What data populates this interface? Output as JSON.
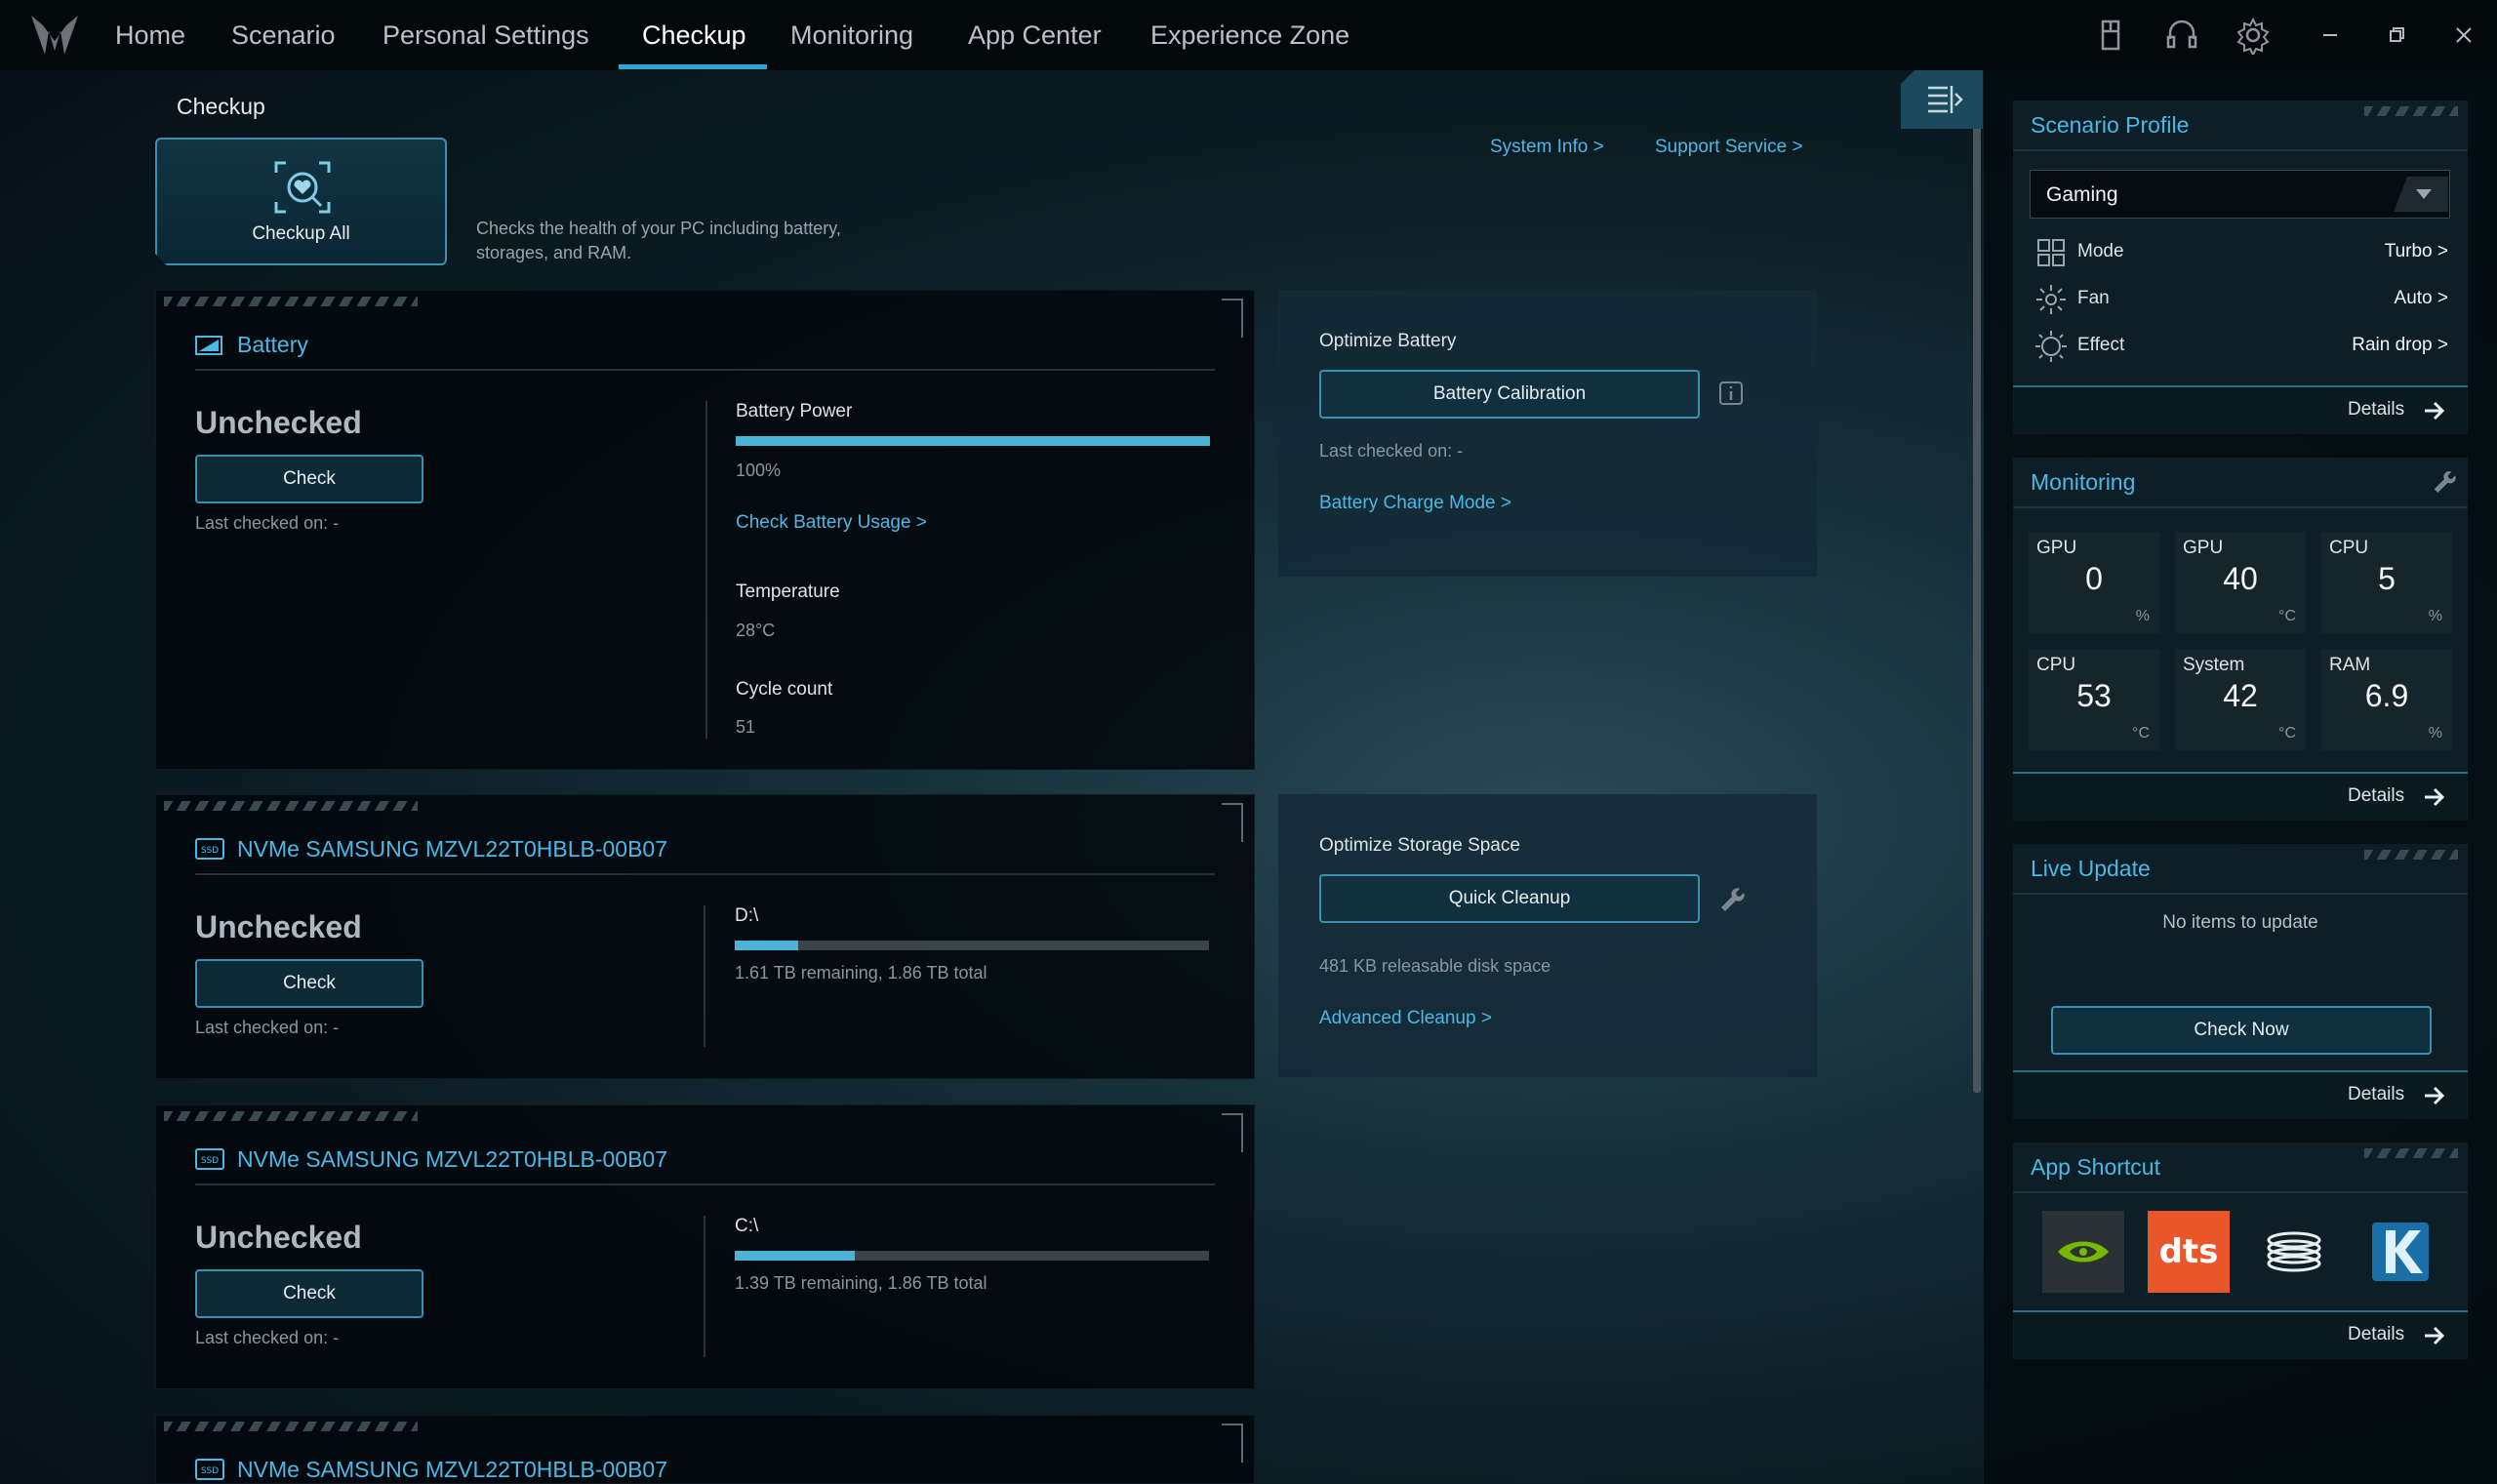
{
  "nav": {
    "tabs": [
      "Home",
      "Scenario",
      "Personal Settings",
      "Checkup",
      "Monitoring",
      "App Center",
      "Experience Zone"
    ],
    "active": "Checkup"
  },
  "page": {
    "title": "Checkup",
    "checkup_all_label": "Checkup All",
    "description": "Checks the health of your PC including battery, storages, and RAM.",
    "system_info_link": "System Info >",
    "support_link": "Support Service >"
  },
  "battery": {
    "title": "Battery",
    "status": "Unchecked",
    "check_label": "Check",
    "last_checked": "Last checked on: -",
    "power_label": "Battery Power",
    "power_value": "100%",
    "power_fraction": 1.0,
    "usage_link": "Check Battery Usage >",
    "temp_label": "Temperature",
    "temp_value": "28°C",
    "cycle_label": "Cycle count",
    "cycle_value": "51"
  },
  "optimize_battery": {
    "title": "Optimize Battery",
    "button": "Battery Calibration",
    "last_checked": "Last checked on: -",
    "charge_mode_link": "Battery Charge Mode >"
  },
  "storages": [
    {
      "title": "NVMe SAMSUNG MZVL22T0HBLB-00B07",
      "status": "Unchecked",
      "check_label": "Check",
      "last_checked": "Last checked on: -",
      "drive": "D:\\",
      "summary": "1.61 TB remaining, 1.86 TB total",
      "used_fraction": 0.134
    },
    {
      "title": "NVMe SAMSUNG MZVL22T0HBLB-00B07",
      "status": "Unchecked",
      "check_label": "Check",
      "last_checked": "Last checked on: -",
      "drive": "C:\\",
      "summary": "1.39 TB remaining, 1.86 TB total",
      "used_fraction": 0.253
    },
    {
      "title": "NVMe SAMSUNG MZVL22T0HBLB-00B07"
    }
  ],
  "optimize_storage": {
    "title": "Optimize Storage Space",
    "button": "Quick Cleanup",
    "releasable": "481 KB releasable disk space",
    "advanced_link": "Advanced Cleanup >"
  },
  "sidebar": {
    "scenario": {
      "title": "Scenario Profile",
      "selected": "Gaming",
      "rows": [
        {
          "label": "Mode",
          "value": "Turbo >"
        },
        {
          "label": "Fan",
          "value": "Auto >"
        },
        {
          "label": "Effect",
          "value": "Rain drop >"
        }
      ],
      "details": "Details"
    },
    "monitoring": {
      "title": "Monitoring",
      "tiles": [
        {
          "name": "GPU",
          "value": "0",
          "unit": "%"
        },
        {
          "name": "GPU",
          "value": "40",
          "unit": "°C"
        },
        {
          "name": "CPU",
          "value": "5",
          "unit": "%"
        },
        {
          "name": "CPU",
          "value": "53",
          "unit": "°C"
        },
        {
          "name": "System",
          "value": "42",
          "unit": "°C"
        },
        {
          "name": "RAM",
          "value": "6.9",
          "unit": "%"
        }
      ],
      "details": "Details"
    },
    "live_update": {
      "title": "Live Update",
      "message": "No items to update",
      "button": "Check Now",
      "details": "Details"
    },
    "app_shortcut": {
      "title": "App Shortcut",
      "apps": [
        "nvidia-icon",
        "dts-icon",
        "disc-stack-icon",
        "k-app-icon"
      ],
      "dts_text": "dts",
      "details": "Details"
    }
  },
  "colors": {
    "accent": "#4cb8e6",
    "active_tab": "#29a9d8",
    "dts": "#e8562a",
    "nvidia": "#76b900"
  }
}
